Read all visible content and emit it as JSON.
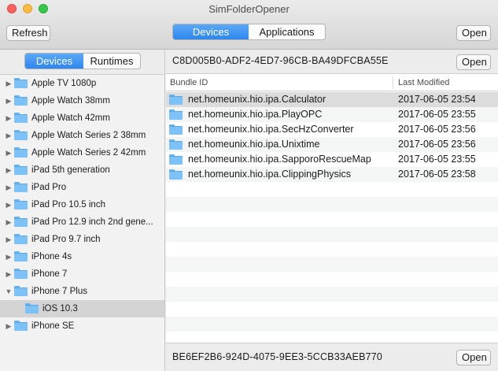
{
  "window": {
    "title": "SimFolderOpener"
  },
  "toolbar": {
    "refresh_label": "Refresh",
    "mode_tabs": [
      "Devices",
      "Applications"
    ],
    "active_mode": "Devices",
    "open_label": "Open"
  },
  "sidebar": {
    "tabs": [
      "Devices",
      "Runtimes"
    ],
    "active_tab": "Devices",
    "items": [
      {
        "label": "Apple TV 1080p",
        "expanded": false
      },
      {
        "label": "Apple Watch 38mm",
        "expanded": false
      },
      {
        "label": "Apple Watch 42mm",
        "expanded": false
      },
      {
        "label": "Apple Watch Series 2 38mm",
        "expanded": false
      },
      {
        "label": "Apple Watch Series 2 42mm",
        "expanded": false
      },
      {
        "label": "iPad  5th generation",
        "expanded": false
      },
      {
        "label": "iPad Pro",
        "expanded": false
      },
      {
        "label": "iPad Pro  10.5 inch",
        "expanded": false
      },
      {
        "label": "iPad Pro  12.9 inch   2nd gene...",
        "expanded": false
      },
      {
        "label": "iPad Pro  9.7 inch",
        "expanded": false
      },
      {
        "label": "iPhone 4s",
        "expanded": false
      },
      {
        "label": "iPhone 7",
        "expanded": false
      },
      {
        "label": "iPhone 7 Plus",
        "expanded": true
      },
      {
        "label": "iOS 10.3",
        "child": true,
        "selected": true
      },
      {
        "label": "iPhone SE",
        "expanded": false
      }
    ]
  },
  "main": {
    "device_path": "C8D005B0-ADF2-4ED7-96CB-BA49DFCBA55E",
    "open_label": "Open",
    "columns": {
      "bundle_id": "Bundle ID",
      "last_modified": "Last Modified"
    },
    "rows": [
      {
        "bundle_id": "net.homeunix.hio.ipa.Calculator",
        "last_modified": "2017-06-05 23:54",
        "selected": true
      },
      {
        "bundle_id": "net.homeunix.hio.ipa.PlayOPC",
        "last_modified": "2017-06-05 23:55"
      },
      {
        "bundle_id": "net.homeunix.hio.ipa.SecHzConverter",
        "last_modified": "2017-06-05 23:56"
      },
      {
        "bundle_id": "net.homeunix.hio.ipa.Unixtime",
        "last_modified": "2017-06-05 23:56"
      },
      {
        "bundle_id": "net.homeunix.hio.ipa.SapporoRescueMap",
        "last_modified": "2017-06-05 23:55"
      },
      {
        "bundle_id": "net.homeunix.hio.ipa.ClippingPhysics",
        "last_modified": "2017-06-05 23:58"
      }
    ],
    "empty_rows": 12,
    "app_path": "BE6EF2B6-924D-4075-9EE3-5CCB33AEB770",
    "bottom_open_label": "Open"
  },
  "colors": {
    "accent": "#3a8ff0",
    "folder": "#7cc2f8",
    "selection": "#dcdcdc"
  }
}
